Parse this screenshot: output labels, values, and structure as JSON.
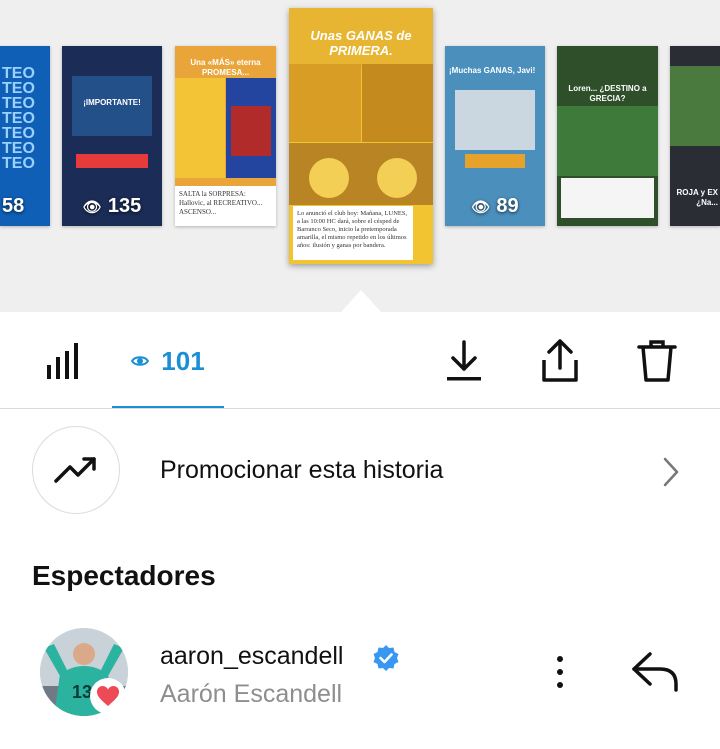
{
  "stories": {
    "thumbnails": [
      {
        "view_count": "58",
        "caption": "TEO\nTEO\nTEO\nTEO\nTEO\nTEO\nTEO"
      },
      {
        "view_count": "135",
        "caption": "¡IMPORTANTE!"
      },
      {
        "view_count": "",
        "caption": "Una «MÁS» eterna PROMESA..."
      },
      {
        "view_count": "89",
        "caption": "¡Muchas GANAS, Javi!"
      },
      {
        "view_count": "",
        "caption": "Loren... ¿DESTINO a GRECIA?"
      },
      {
        "view_count": "",
        "caption": "ROJA y EX ¿Na..."
      }
    ],
    "selected": {
      "title": "Unas GANAS de PRIMERA.",
      "caption": "Lo anunció el club hoy: Mañana, LUNES, a las 10:00 HC dará, sobre el césped de Barranco Seco, inicio la pretemporada amarilla, el mismo repetido en los últimos años: ilusión y ganas por bandera."
    },
    "thumb3_sub": "SALTA la SORPRESA: Hallovic, al RECREATIVO... ASCENSO..."
  },
  "toolbar": {
    "views_count": "101"
  },
  "promote": {
    "label": "Promocionar esta historia"
  },
  "viewers": {
    "title": "Espectadores",
    "items": [
      {
        "username": "aaron_escandell",
        "full_name": "Aarón Escandell",
        "verified": true,
        "liked": true
      }
    ]
  },
  "colors": {
    "accent": "#1a8fd6",
    "heart": "#ed4956",
    "verified": "#3897f0"
  }
}
